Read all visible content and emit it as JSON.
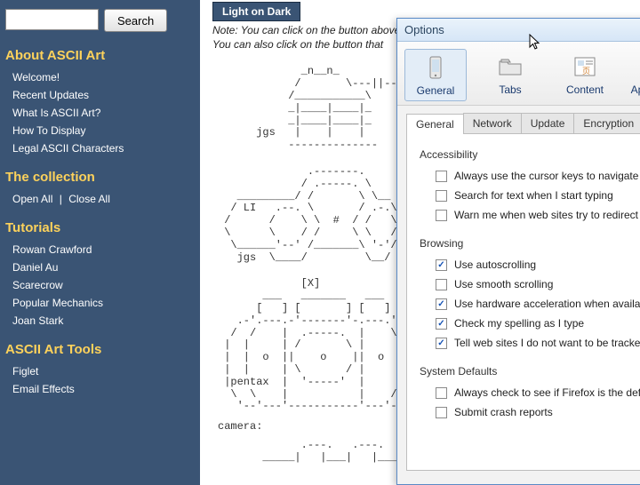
{
  "sidebar": {
    "search_button": "Search",
    "sections": [
      {
        "title": "About ASCII Art",
        "items": [
          "Welcome!",
          "Recent Updates",
          "What Is ASCII Art?",
          "How To Display",
          "Legal ASCII Characters"
        ]
      },
      {
        "title": "The collection",
        "open": "Open All",
        "close": "Close All"
      },
      {
        "title": "Tutorials",
        "items": [
          "Rowan Crawford",
          "Daniel Au",
          "Scarecrow",
          "Popular Mechanics",
          "Joan Stark"
        ]
      },
      {
        "title": "ASCII Art Tools",
        "items": [
          "Figlet",
          "Email Effects"
        ]
      }
    ]
  },
  "content": {
    "button_lod": "Light on Dark",
    "note1": "Note: You can click on the button above",
    "note2": "You can also click on the button that",
    "ascii1": "             _n__n_\n            /       \\---||--<\n           /___________\\\n           _|____|____|_\n           _|____|____|_\n      jgs   |    |    |\n           --------------\n",
    "ascii2": "              .-------.\n             / .-----. \\\n   _________/ /       \\ \\__\n  / LI   .--. \\       / .-.\\\n /      /    \\ \\  #  / /   \\\\\n \\      \\    / /     \\ \\   //\n  \\______'--' /_______\\ '-'/\n   jgs  \\____/         \\__/\n",
    "ascii3": "             [X]\n       ___   _______   ___\n      [   ] [       ] [   ]\n   .-'.---.-'-------'-.---.'-. \n  /  /    |  .-----.  |    \\  \\\n |  |     | /       \\ |     |  |\n |  |  o  ||    o    ||  o  |  |\n |  |     | \\       / |     |  |\n |pentax  |  '-----'  |     |  |\n  \\  \\    |           |    /  /\n   '--'---'-----------'---'--'    hj\n",
    "label_camera": "camera:",
    "ascii4": "             .---.   .---.\n       _____|   |___|   |____\n"
  },
  "dialog": {
    "title": "Options",
    "tools": [
      "General",
      "Tabs",
      "Content",
      "Applications"
    ],
    "tabs": [
      "General",
      "Network",
      "Update",
      "Encryption"
    ],
    "group1": "Accessibility",
    "group2": "Browsing",
    "group3": "System Defaults",
    "checks": [
      {
        "label": "Always use the cursor keys to navigate w",
        "checked": false
      },
      {
        "label": "Search for text when I start typing",
        "checked": false
      },
      {
        "label": "Warn me when web sites try to redirect o",
        "checked": false
      },
      {
        "label": "Use autoscrolling",
        "checked": true
      },
      {
        "label": "Use smooth scrolling",
        "checked": false
      },
      {
        "label": "Use hardware acceleration when availabl",
        "checked": true
      },
      {
        "label": "Check my spelling as I type",
        "checked": true
      },
      {
        "label": "Tell web sites I do not want to be tracke",
        "checked": true
      },
      {
        "label": "Always check to see if Firefox is the defa",
        "checked": false
      },
      {
        "label": "Submit crash reports",
        "checked": false
      }
    ]
  }
}
